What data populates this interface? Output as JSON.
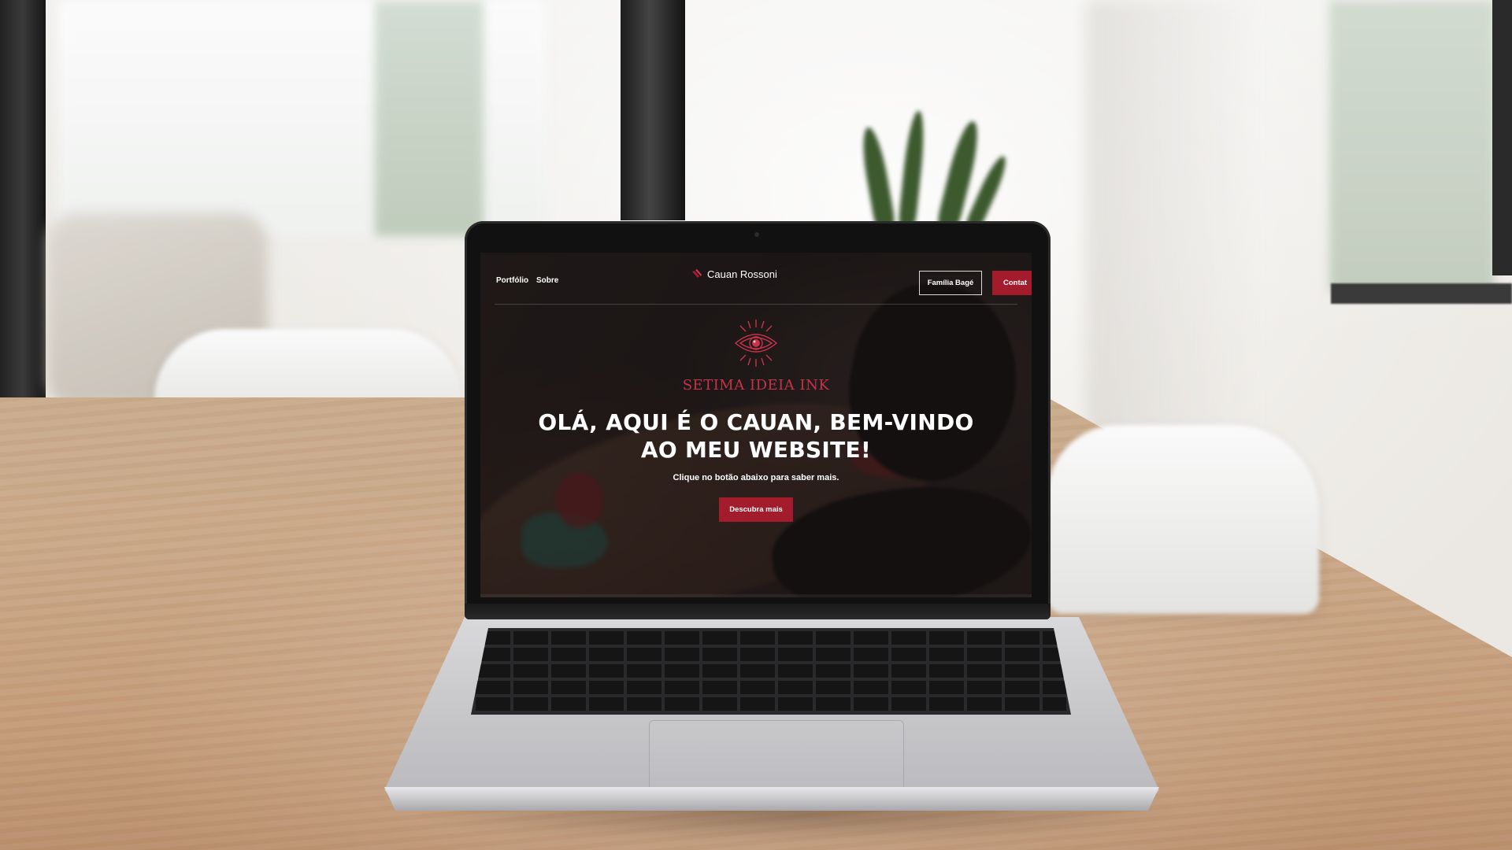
{
  "website": {
    "nav": {
      "left_links": [
        "Portfólio",
        "Sobre"
      ],
      "brand_name": "Cauan Rossoni",
      "outline_button": "Família Bagé",
      "cta_button": "Contat"
    },
    "hero": {
      "logo_text": "SETIMA IDEIA INK",
      "title": "OLÁ, AQUI É O CAUAN, BEM-VINDO AO MEU WEBSITE!",
      "subtitle": "Clique no botão abaixo para saber mais.",
      "cta_label": "Descubra mais"
    },
    "colors": {
      "accent": "#a31c2b",
      "logo": "#c8324a",
      "text": "#ffffff"
    },
    "icons": {
      "brand": "brand-mark-icon",
      "logo": "eye-sun-logo-icon"
    }
  }
}
